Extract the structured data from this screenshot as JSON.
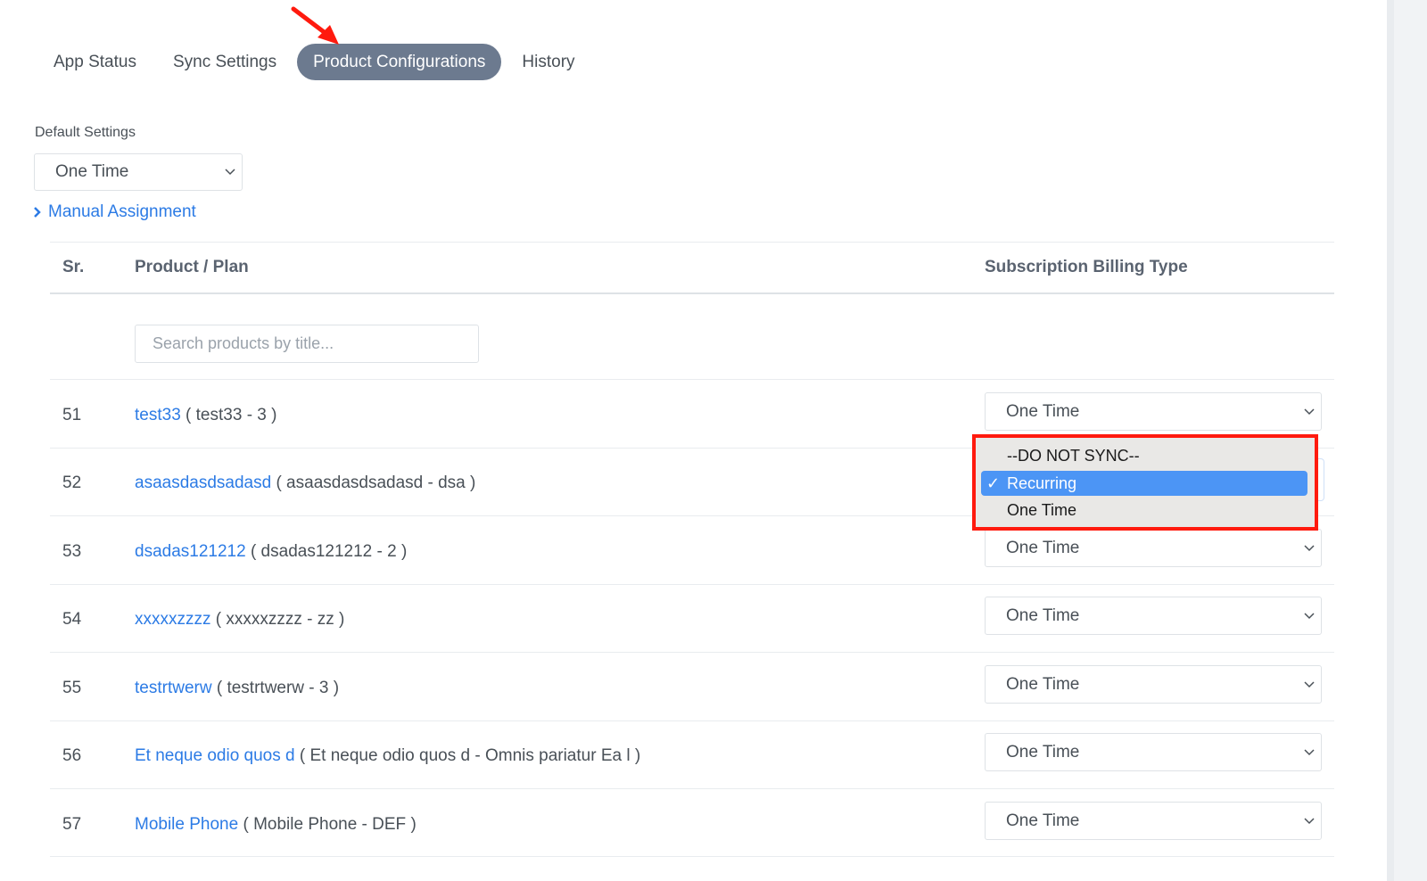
{
  "tabs": [
    {
      "label": "App Status"
    },
    {
      "label": "Sync Settings"
    },
    {
      "label": "Product Configurations"
    },
    {
      "label": "History"
    }
  ],
  "default_settings": {
    "label": "Default Settings",
    "value": "One Time"
  },
  "manual_assignment": "Manual Assignment",
  "table": {
    "headers": {
      "sr": "Sr.",
      "product": "Product / Plan",
      "billing": "Subscription Billing Type"
    },
    "search_placeholder": "Search products by title...",
    "rows": [
      {
        "sr": "51",
        "name": "test33",
        "detail": "( test33 - 3 )",
        "billing": "One Time"
      },
      {
        "sr": "52",
        "name": "asaasdasdsadasd",
        "detail": "( asaasdasdsadasd - dsa )",
        "billing": "Recurring"
      },
      {
        "sr": "53",
        "name": "dsadas121212",
        "detail": "( dsadas121212 - 2 )",
        "billing": "One Time"
      },
      {
        "sr": "54",
        "name": "xxxxxzzzz",
        "detail": "( xxxxxzzzz - zz )",
        "billing": "One Time"
      },
      {
        "sr": "55",
        "name": "testrtwerw",
        "detail": "( testrtwerw - 3 )",
        "billing": "One Time"
      },
      {
        "sr": "56",
        "name": "Et neque odio quos d",
        "detail": "( Et neque odio quos d - Omnis pariatur Ea l )",
        "billing": "One Time"
      },
      {
        "sr": "57",
        "name": "Mobile Phone",
        "detail": "( Mobile Phone - DEF )",
        "billing": "One Time"
      }
    ]
  },
  "dropdown": {
    "options": [
      "--DO NOT SYNC--",
      "Recurring",
      "One Time"
    ],
    "selected": "Recurring",
    "check": "✓"
  },
  "colors": {
    "active_tab": "#6c7a8f",
    "link": "#2c7be5",
    "highlight": "#4c95f5",
    "annotation": "#ff1a0e"
  }
}
